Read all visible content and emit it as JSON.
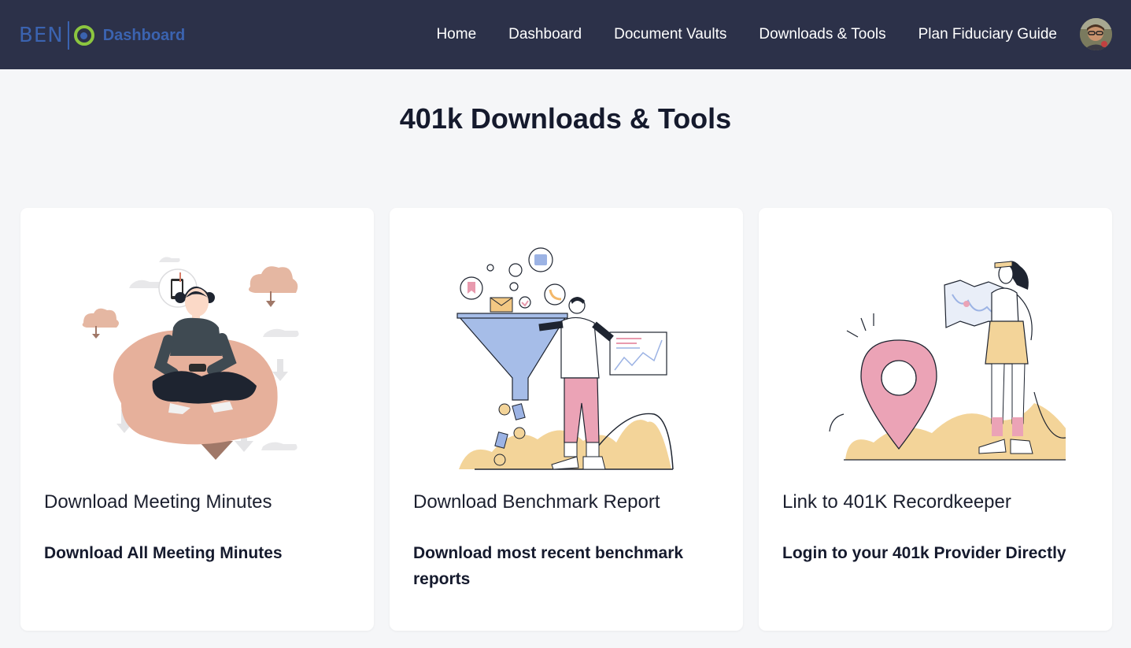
{
  "brand": {
    "logo_text": "BEN",
    "logo_mark": "G",
    "title": "Dashboard"
  },
  "nav": {
    "items": [
      {
        "label": "Home"
      },
      {
        "label": "Dashboard"
      },
      {
        "label": "Document Vaults"
      },
      {
        "label": "Downloads & Tools"
      },
      {
        "label": "Plan Fiduciary Guide"
      }
    ],
    "avatar_icon": "user-avatar"
  },
  "page": {
    "title": "401k Downloads & Tools"
  },
  "cards": [
    {
      "title": "Download Meeting Minutes",
      "description": "Download All Meeting Minutes",
      "illustration": "woman-downloading-on-beanbag"
    },
    {
      "title": "Download Benchmark Report",
      "description": "Download most recent benchmark reports",
      "illustration": "man-with-funnel-and-chart"
    },
    {
      "title": "Link to 401K Recordkeeper",
      "description": "Login to your 401k Provider Directly",
      "illustration": "woman-with-map-and-location-pin"
    }
  ],
  "colors": {
    "navbar_bg": "#2c3149",
    "brand_blue": "#3b63b0",
    "brand_green": "#8cc63f",
    "page_bg": "#f5f6f8",
    "card_bg": "#ffffff"
  }
}
